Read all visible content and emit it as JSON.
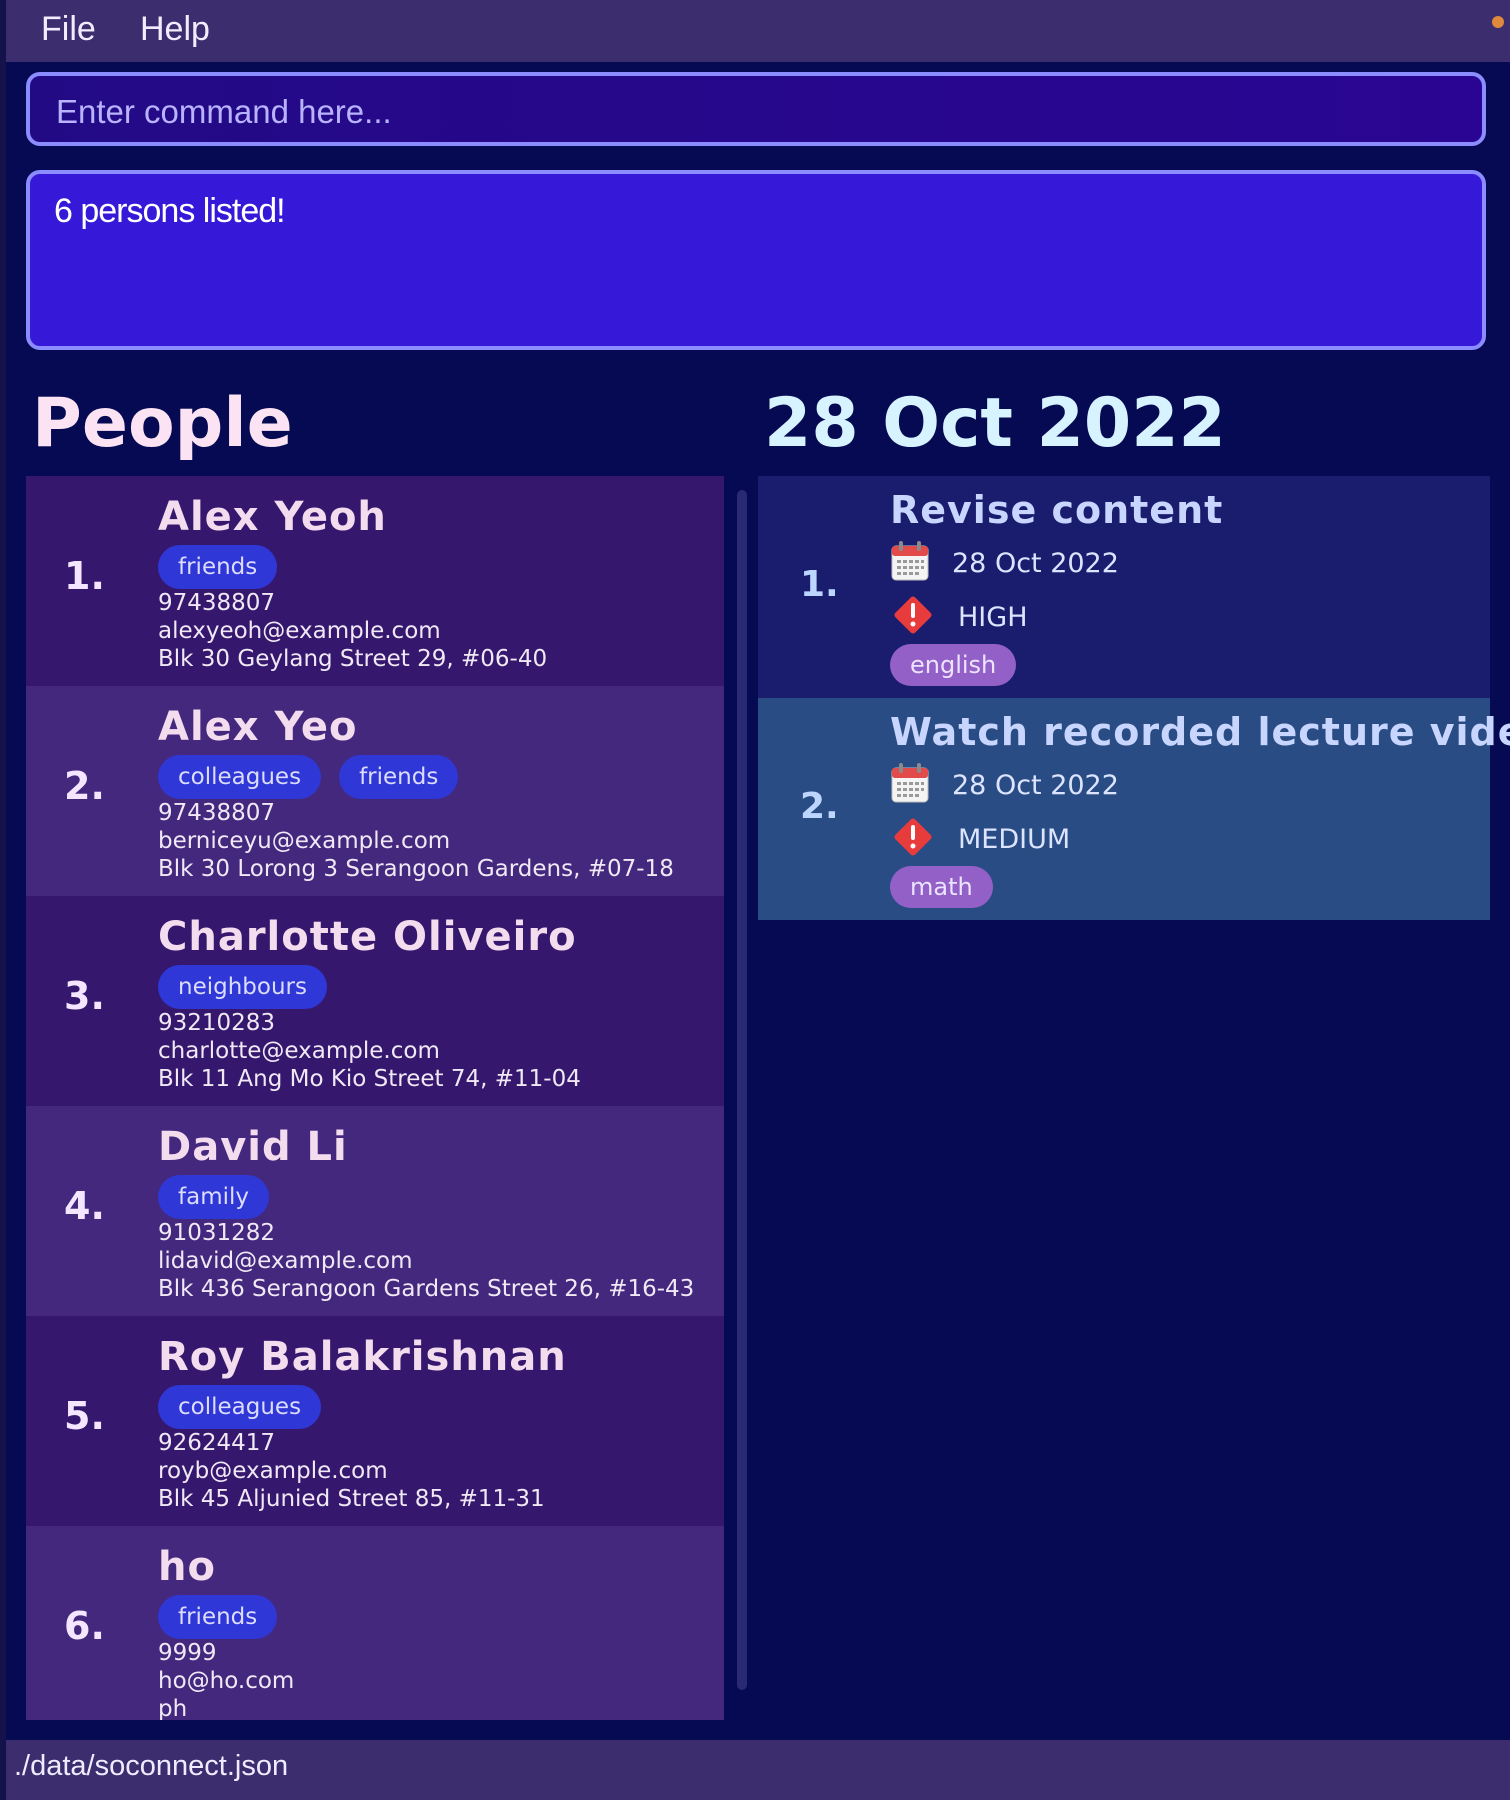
{
  "menu": {
    "file": "File",
    "help": "Help"
  },
  "command": {
    "placeholder": "Enter command here..."
  },
  "result": {
    "message": "6 persons listed!"
  },
  "people": {
    "heading": "People",
    "items": [
      {
        "index": "1.",
        "name": "Alex Yeoh",
        "tags": [
          "friends"
        ],
        "phone": "97438807",
        "email": "alexyeoh@example.com",
        "address": "Blk 30 Geylang Street 29, #06-40"
      },
      {
        "index": "2.",
        "name": "Alex Yeo",
        "tags": [
          "colleagues",
          "friends"
        ],
        "phone": "97438807",
        "email": "berniceyu@example.com",
        "address": "Blk 30 Lorong 3 Serangoon Gardens, #07-18"
      },
      {
        "index": "3.",
        "name": "Charlotte Oliveiro",
        "tags": [
          "neighbours"
        ],
        "phone": "93210283",
        "email": "charlotte@example.com",
        "address": "Blk 11 Ang Mo Kio Street 74, #11-04"
      },
      {
        "index": "4.",
        "name": "David Li",
        "tags": [
          "family"
        ],
        "phone": "91031282",
        "email": "lidavid@example.com",
        "address": "Blk 436 Serangoon Gardens Street 26, #16-43"
      },
      {
        "index": "5.",
        "name": "Roy Balakrishnan",
        "tags": [
          "colleagues"
        ],
        "phone": "92624417",
        "email": "royb@example.com",
        "address": "Blk 45 Aljunied Street 85, #11-31"
      },
      {
        "index": "6.",
        "name": "ho",
        "tags": [
          "friends"
        ],
        "phone": "9999",
        "email": "ho@ho.com",
        "address": "ph"
      }
    ]
  },
  "tasks": {
    "heading": "28 Oct 2022",
    "items": [
      {
        "index": "1.",
        "title": "Revise content",
        "date": "28 Oct 2022",
        "priority": "HIGH",
        "tag": "english"
      },
      {
        "index": "2.",
        "title": "Watch recorded lecture videos",
        "date": "28 Oct 2022",
        "priority": "MEDIUM",
        "tag": "math"
      }
    ]
  },
  "footer": {
    "path": "./data/soconnect.json"
  },
  "colors": {
    "accent": "#3618d8",
    "tag": "#2f37d6",
    "task_tag": "#9360c8",
    "priority": "#e83b3b"
  }
}
